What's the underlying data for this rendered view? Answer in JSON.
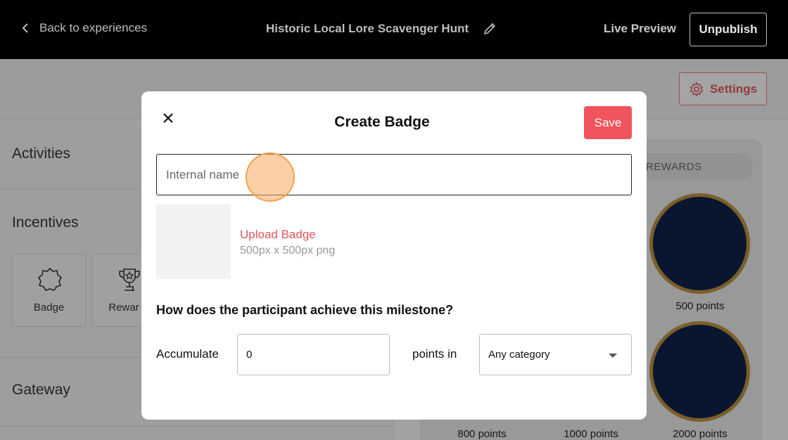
{
  "topbar": {
    "back_label": "Back to experiences",
    "title": "Historic Local Lore Scavenger Hunt",
    "live_preview": "Live Preview",
    "unpublish": "Unpublish"
  },
  "page": {
    "settings": "Settings",
    "sections": [
      "Activities",
      "Incentives",
      "Gateway"
    ],
    "tiles": [
      "Badge",
      "Rewar"
    ],
    "rewards_tab": "REWARDS",
    "points": [
      "500 points",
      "800 points",
      "1000 points",
      "2000 points"
    ]
  },
  "modal": {
    "title": "Create Badge",
    "save": "Save",
    "name_placeholder": "Internal name",
    "upload_label": "Upload Badge",
    "upload_hint": "500px x 500px png",
    "question": "How does the participant achieve this milestone?",
    "accumulate_label": "Accumulate",
    "points_value": "0",
    "points_in_label": "points in",
    "category_value": "Any category"
  },
  "colors": {
    "accent": "#f0545c",
    "topbar": "#000000"
  }
}
